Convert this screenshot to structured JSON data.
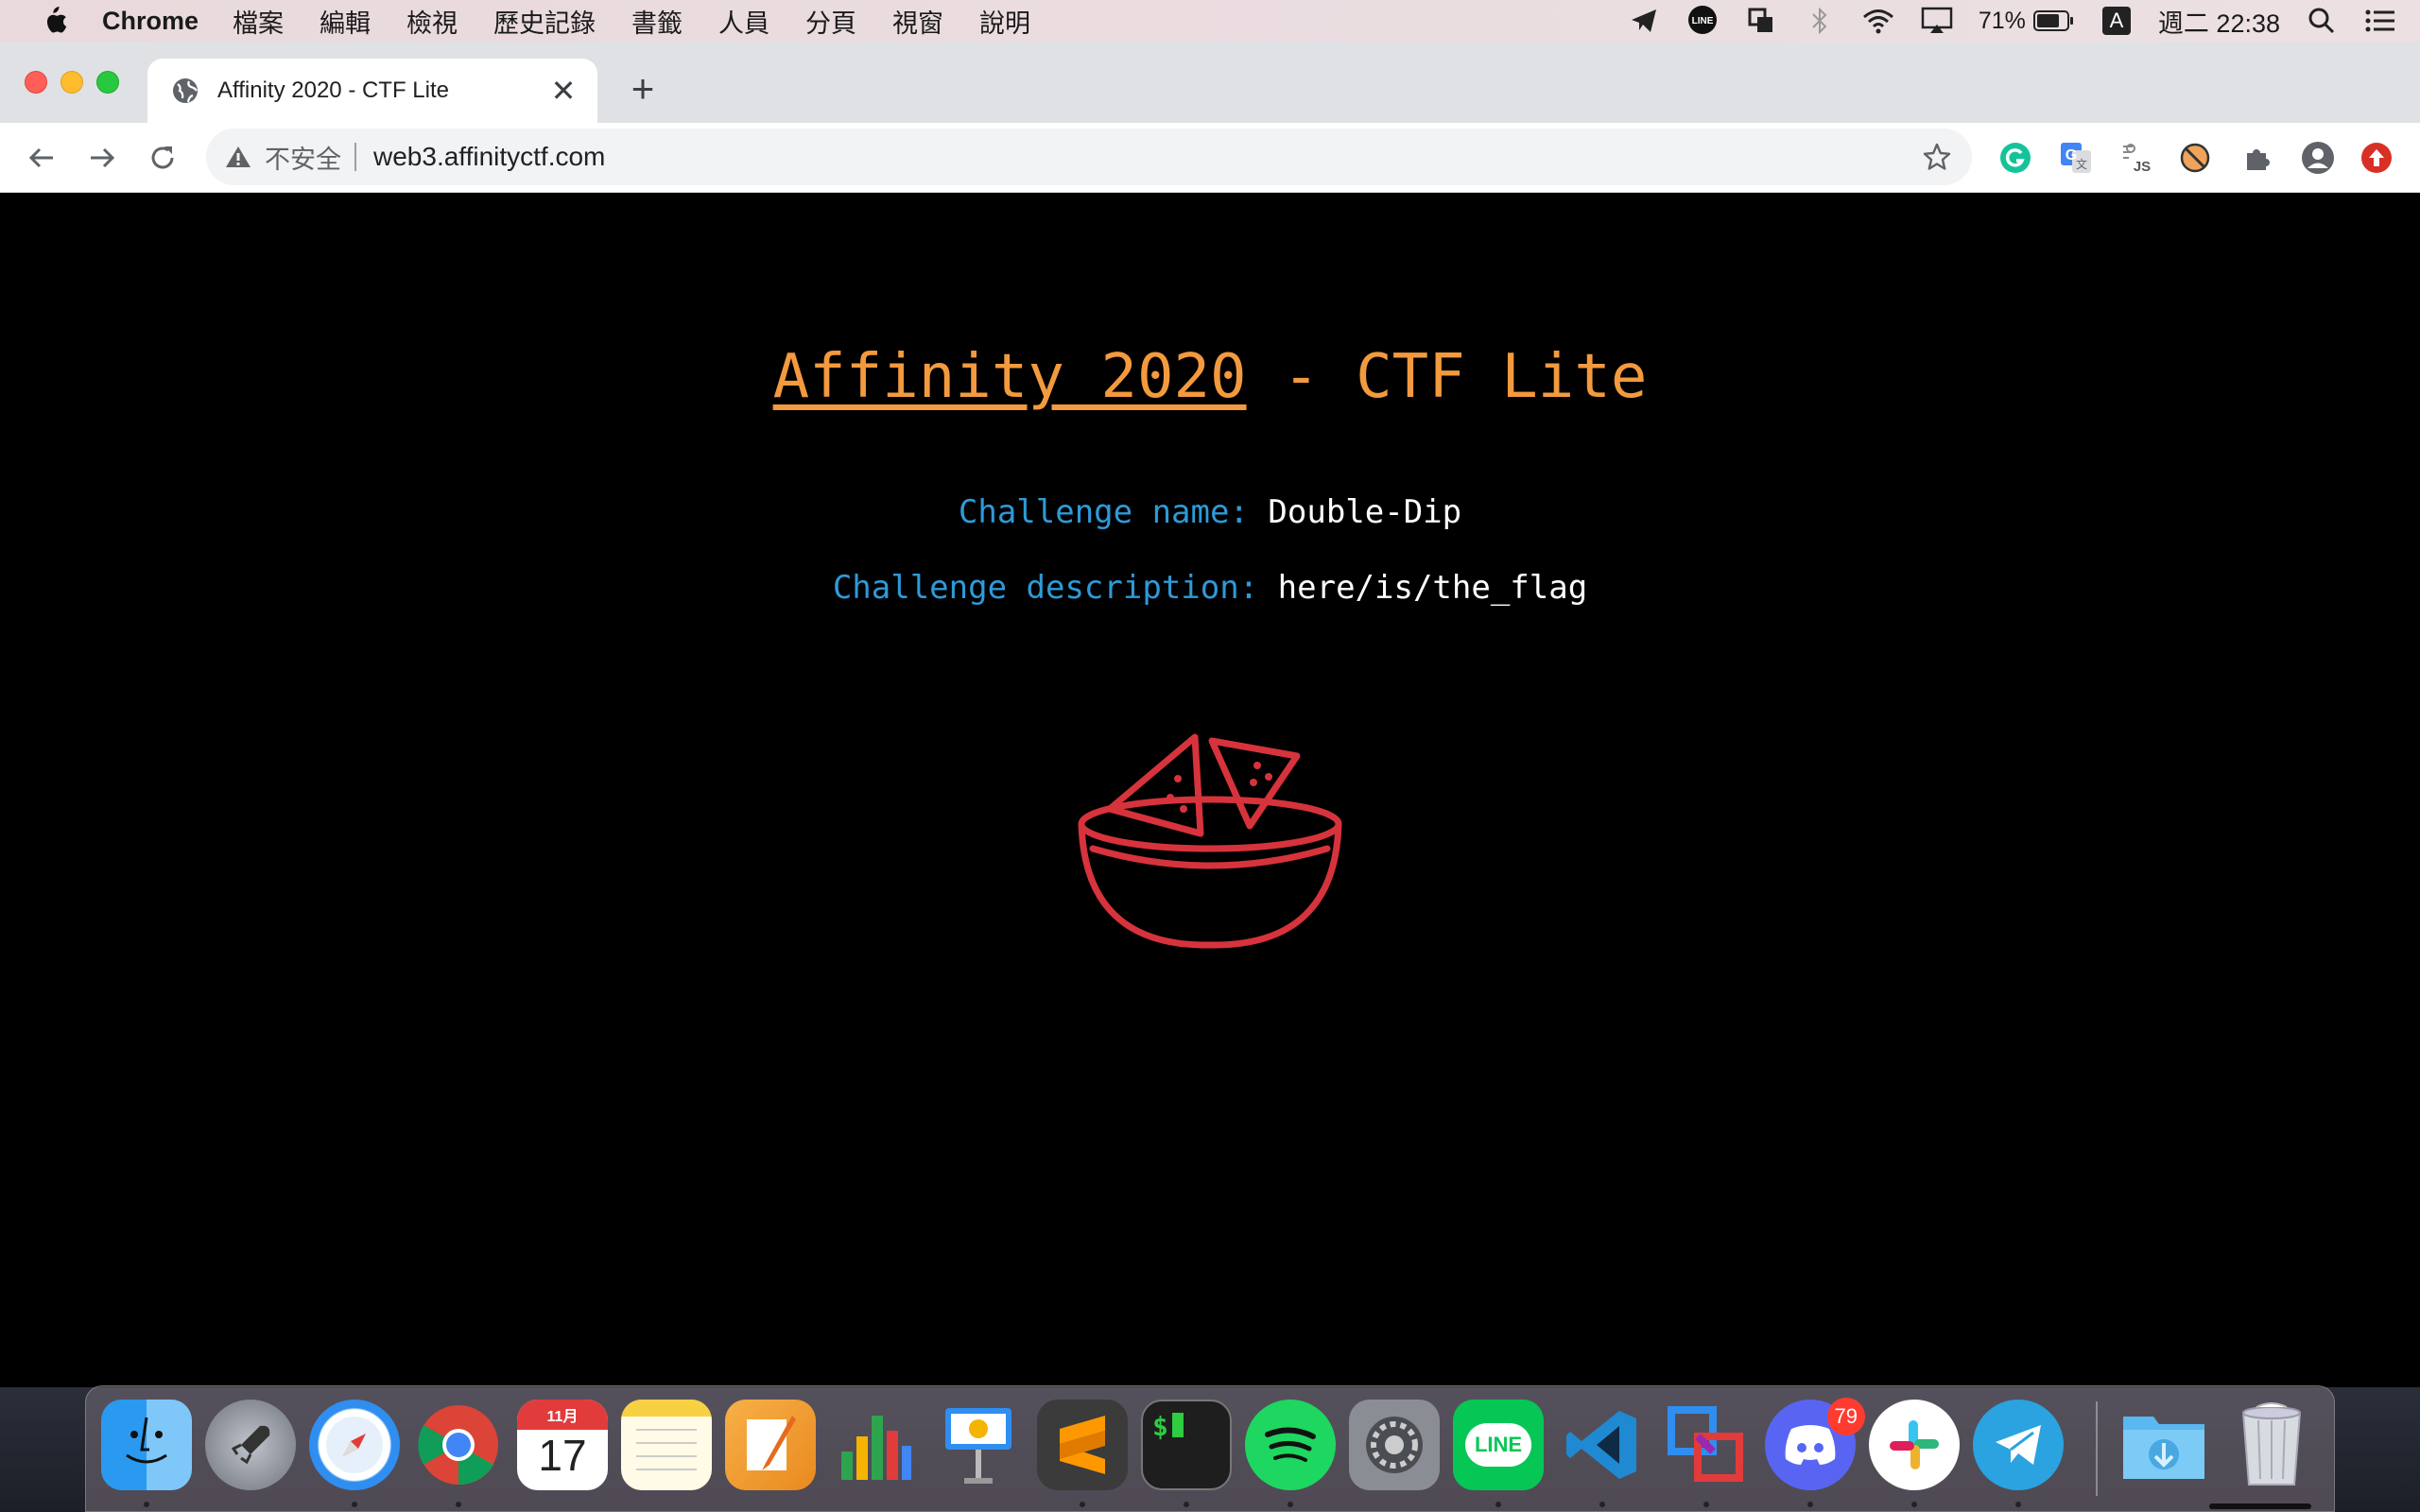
{
  "menubar": {
    "app_name": "Chrome",
    "items": [
      "檔案",
      "編輯",
      "檢視",
      "歷史記錄",
      "書籤",
      "人員",
      "分頁",
      "視窗",
      "說明"
    ],
    "battery": "71%",
    "input_method": "A",
    "clock": "週二 22:38",
    "status_icons": [
      "telegram-send-icon",
      "line-icon",
      "overlay-icon",
      "bluetooth-icon",
      "wifi-icon",
      "airplay-icon",
      "battery-icon",
      "input-method-icon",
      "spotlight-icon",
      "notification-center-icon"
    ]
  },
  "tab": {
    "title": "Affinity 2020 - CTF Lite",
    "close": "✕"
  },
  "new_tab": "+",
  "toolbar": {
    "security_label": "不安全",
    "url": "web3.affinityctf.com",
    "extensions": [
      "grammarly-icon",
      "google-translate-icon",
      "js-extension-icon",
      "blocker-extension-icon",
      "extensions-puzzle-icon",
      "profile-avatar-icon",
      "update-icon"
    ]
  },
  "page": {
    "heading_link": "Affinity 2020",
    "heading_rest": " - CTF Lite",
    "name_label": "Challenge name:",
    "name_value": "Double-Dip",
    "desc_label": "Challenge description:",
    "desc_value": "here/is/the_flag"
  },
  "colors": {
    "heading": "#f39a3e",
    "label": "#2e9ad8",
    "value": "#ffffff",
    "nachos": "#d7333d",
    "background": "#000000"
  },
  "dock": {
    "apps": [
      "Finder",
      "Launchpad",
      "Safari",
      "Chrome",
      "Calendar",
      "Notes",
      "Pages",
      "Numbers",
      "Keynote",
      "Sublime Text",
      "Terminal",
      "Spotify",
      "System Preferences",
      "LINE",
      "VS Code",
      "VMware",
      "Discord",
      "Slack",
      "Telegram",
      "Downloads",
      "Trash"
    ],
    "calendar_month": "11月",
    "calendar_day": "17",
    "line_label": "LINE",
    "discord_badge": "79",
    "terminal_prompt": "$"
  }
}
